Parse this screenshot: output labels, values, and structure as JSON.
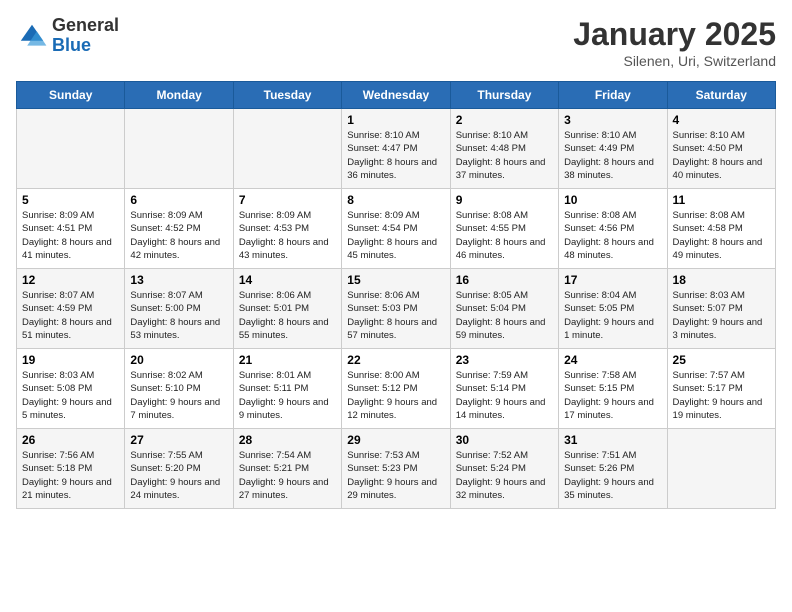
{
  "header": {
    "logo_general": "General",
    "logo_blue": "Blue",
    "title": "January 2025",
    "subtitle": "Silenen, Uri, Switzerland"
  },
  "weekdays": [
    "Sunday",
    "Monday",
    "Tuesday",
    "Wednesday",
    "Thursday",
    "Friday",
    "Saturday"
  ],
  "weeks": [
    [
      {
        "day": "",
        "info": ""
      },
      {
        "day": "",
        "info": ""
      },
      {
        "day": "",
        "info": ""
      },
      {
        "day": "1",
        "info": "Sunrise: 8:10 AM\nSunset: 4:47 PM\nDaylight: 8 hours and 36 minutes."
      },
      {
        "day": "2",
        "info": "Sunrise: 8:10 AM\nSunset: 4:48 PM\nDaylight: 8 hours and 37 minutes."
      },
      {
        "day": "3",
        "info": "Sunrise: 8:10 AM\nSunset: 4:49 PM\nDaylight: 8 hours and 38 minutes."
      },
      {
        "day": "4",
        "info": "Sunrise: 8:10 AM\nSunset: 4:50 PM\nDaylight: 8 hours and 40 minutes."
      }
    ],
    [
      {
        "day": "5",
        "info": "Sunrise: 8:09 AM\nSunset: 4:51 PM\nDaylight: 8 hours and 41 minutes."
      },
      {
        "day": "6",
        "info": "Sunrise: 8:09 AM\nSunset: 4:52 PM\nDaylight: 8 hours and 42 minutes."
      },
      {
        "day": "7",
        "info": "Sunrise: 8:09 AM\nSunset: 4:53 PM\nDaylight: 8 hours and 43 minutes."
      },
      {
        "day": "8",
        "info": "Sunrise: 8:09 AM\nSunset: 4:54 PM\nDaylight: 8 hours and 45 minutes."
      },
      {
        "day": "9",
        "info": "Sunrise: 8:08 AM\nSunset: 4:55 PM\nDaylight: 8 hours and 46 minutes."
      },
      {
        "day": "10",
        "info": "Sunrise: 8:08 AM\nSunset: 4:56 PM\nDaylight: 8 hours and 48 minutes."
      },
      {
        "day": "11",
        "info": "Sunrise: 8:08 AM\nSunset: 4:58 PM\nDaylight: 8 hours and 49 minutes."
      }
    ],
    [
      {
        "day": "12",
        "info": "Sunrise: 8:07 AM\nSunset: 4:59 PM\nDaylight: 8 hours and 51 minutes."
      },
      {
        "day": "13",
        "info": "Sunrise: 8:07 AM\nSunset: 5:00 PM\nDaylight: 8 hours and 53 minutes."
      },
      {
        "day": "14",
        "info": "Sunrise: 8:06 AM\nSunset: 5:01 PM\nDaylight: 8 hours and 55 minutes."
      },
      {
        "day": "15",
        "info": "Sunrise: 8:06 AM\nSunset: 5:03 PM\nDaylight: 8 hours and 57 minutes."
      },
      {
        "day": "16",
        "info": "Sunrise: 8:05 AM\nSunset: 5:04 PM\nDaylight: 8 hours and 59 minutes."
      },
      {
        "day": "17",
        "info": "Sunrise: 8:04 AM\nSunset: 5:05 PM\nDaylight: 9 hours and 1 minute."
      },
      {
        "day": "18",
        "info": "Sunrise: 8:03 AM\nSunset: 5:07 PM\nDaylight: 9 hours and 3 minutes."
      }
    ],
    [
      {
        "day": "19",
        "info": "Sunrise: 8:03 AM\nSunset: 5:08 PM\nDaylight: 9 hours and 5 minutes."
      },
      {
        "day": "20",
        "info": "Sunrise: 8:02 AM\nSunset: 5:10 PM\nDaylight: 9 hours and 7 minutes."
      },
      {
        "day": "21",
        "info": "Sunrise: 8:01 AM\nSunset: 5:11 PM\nDaylight: 9 hours and 9 minutes."
      },
      {
        "day": "22",
        "info": "Sunrise: 8:00 AM\nSunset: 5:12 PM\nDaylight: 9 hours and 12 minutes."
      },
      {
        "day": "23",
        "info": "Sunrise: 7:59 AM\nSunset: 5:14 PM\nDaylight: 9 hours and 14 minutes."
      },
      {
        "day": "24",
        "info": "Sunrise: 7:58 AM\nSunset: 5:15 PM\nDaylight: 9 hours and 17 minutes."
      },
      {
        "day": "25",
        "info": "Sunrise: 7:57 AM\nSunset: 5:17 PM\nDaylight: 9 hours and 19 minutes."
      }
    ],
    [
      {
        "day": "26",
        "info": "Sunrise: 7:56 AM\nSunset: 5:18 PM\nDaylight: 9 hours and 21 minutes."
      },
      {
        "day": "27",
        "info": "Sunrise: 7:55 AM\nSunset: 5:20 PM\nDaylight: 9 hours and 24 minutes."
      },
      {
        "day": "28",
        "info": "Sunrise: 7:54 AM\nSunset: 5:21 PM\nDaylight: 9 hours and 27 minutes."
      },
      {
        "day": "29",
        "info": "Sunrise: 7:53 AM\nSunset: 5:23 PM\nDaylight: 9 hours and 29 minutes."
      },
      {
        "day": "30",
        "info": "Sunrise: 7:52 AM\nSunset: 5:24 PM\nDaylight: 9 hours and 32 minutes."
      },
      {
        "day": "31",
        "info": "Sunrise: 7:51 AM\nSunset: 5:26 PM\nDaylight: 9 hours and 35 minutes."
      },
      {
        "day": "",
        "info": ""
      }
    ]
  ]
}
